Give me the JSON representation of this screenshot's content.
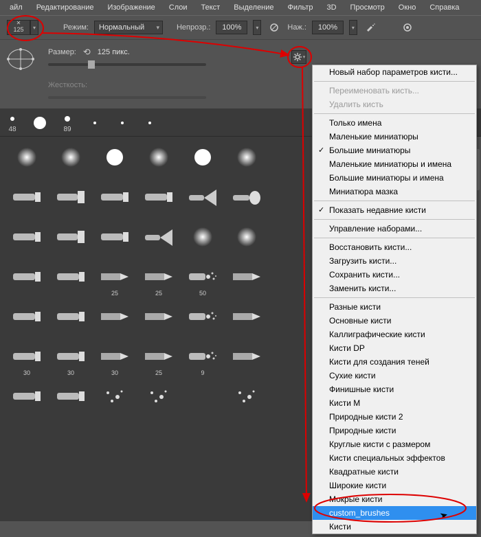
{
  "menubar": [
    "айл",
    "Редактирование",
    "Изображение",
    "Слои",
    "Текст",
    "Выделение",
    "Фильтр",
    "3D",
    "Просмотр",
    "Окно",
    "Справка"
  ],
  "toolbar": {
    "size_value": "125",
    "mode_label": "Режим:",
    "mode_value": "Нормальный",
    "opacity_label": "Непрозр.:",
    "opacity_value": "100%",
    "flow_label": "Наж.:",
    "flow_value": "100%"
  },
  "panel1": {
    "size_label": "Размер:",
    "size_value": "125 пикс.",
    "hardness_label": "Жесткость:"
  },
  "top_brushes": [
    {
      "n": "48"
    },
    {
      "n": ""
    },
    {
      "n": "89"
    },
    {
      "n": ""
    },
    {
      "n": ""
    },
    {
      "n": ""
    }
  ],
  "grid_brushes": [
    {
      "t": "soft"
    },
    {
      "t": "soft"
    },
    {
      "t": "hard"
    },
    {
      "t": "soft"
    },
    {
      "t": "hard"
    },
    {
      "t": "soft"
    },
    {
      "t": "tube"
    },
    {
      "t": "flat"
    },
    {
      "t": "tube"
    },
    {
      "t": "tube"
    },
    {
      "t": "fan"
    },
    {
      "t": "round"
    },
    {
      "t": "tube"
    },
    {
      "t": "flat"
    },
    {
      "t": "tube"
    },
    {
      "t": "fan"
    },
    {
      "t": "soft"
    },
    {
      "t": "soft"
    },
    {
      "t": "tube"
    },
    {
      "t": "tube"
    },
    {
      "t": "pencil",
      "n": "25"
    },
    {
      "t": "pencil",
      "n": "25"
    },
    {
      "t": "spray",
      "n": "50"
    },
    {
      "t": "pencil"
    },
    {
      "t": "tube"
    },
    {
      "t": "tube"
    },
    {
      "t": "pencil"
    },
    {
      "t": "pencil"
    },
    {
      "t": "spray"
    },
    {
      "t": "pencil"
    },
    {
      "t": "tube",
      "n": "30"
    },
    {
      "t": "tube",
      "n": "30"
    },
    {
      "t": "pencil",
      "n": "30"
    },
    {
      "t": "pencil",
      "n": "25"
    },
    {
      "t": "spray",
      "n": "9"
    },
    {
      "t": "pencil"
    },
    {
      "t": "tube"
    },
    {
      "t": "tube"
    },
    {
      "t": "scatter"
    },
    {
      "t": "scatter"
    },
    {
      "t": "blank"
    },
    {
      "t": "scatter"
    }
  ],
  "ctx": [
    {
      "label": "Новый набор параметров кисти...",
      "type": "item"
    },
    {
      "type": "sep"
    },
    {
      "label": "Переименовать кисть...",
      "type": "item",
      "disabled": true
    },
    {
      "label": "Удалить кисть",
      "type": "item",
      "disabled": true
    },
    {
      "type": "sep"
    },
    {
      "label": "Только имена",
      "type": "item"
    },
    {
      "label": "Маленькие миниатюры",
      "type": "item"
    },
    {
      "label": "Большие миниатюры",
      "type": "item",
      "checked": true
    },
    {
      "label": "Маленькие миниатюры и имена",
      "type": "item"
    },
    {
      "label": "Большие миниатюры и имена",
      "type": "item"
    },
    {
      "label": "Миниатюра мазка",
      "type": "item"
    },
    {
      "type": "sep"
    },
    {
      "label": "Показать недавние кисти",
      "type": "item",
      "checked": true
    },
    {
      "type": "sep"
    },
    {
      "label": "Управление наборами...",
      "type": "item"
    },
    {
      "type": "sep"
    },
    {
      "label": "Восстановить кисти...",
      "type": "item"
    },
    {
      "label": "Загрузить кисти...",
      "type": "item"
    },
    {
      "label": "Сохранить кисти...",
      "type": "item"
    },
    {
      "label": "Заменить кисти...",
      "type": "item"
    },
    {
      "type": "sep"
    },
    {
      "label": "Разные кисти",
      "type": "item"
    },
    {
      "label": "Основные кисти",
      "type": "item"
    },
    {
      "label": "Каллиграфические кисти",
      "type": "item"
    },
    {
      "label": "Кисти DP",
      "type": "item"
    },
    {
      "label": "Кисти для создания теней",
      "type": "item"
    },
    {
      "label": "Сухие кисти",
      "type": "item"
    },
    {
      "label": "Финишные кисти",
      "type": "item"
    },
    {
      "label": "Кисти M",
      "type": "item"
    },
    {
      "label": "Природные кисти 2",
      "type": "item"
    },
    {
      "label": "Природные кисти",
      "type": "item"
    },
    {
      "label": "Круглые кисти с размером",
      "type": "item"
    },
    {
      "label": "Кисти специальных эффектов",
      "type": "item"
    },
    {
      "label": "Квадратные кисти",
      "type": "item"
    },
    {
      "label": "Широкие кисти",
      "type": "item"
    },
    {
      "label": "Мокрые кисти",
      "type": "item"
    },
    {
      "label": "custom_brushes",
      "type": "item",
      "selected": true
    },
    {
      "label": "Кисти",
      "type": "item"
    }
  ]
}
